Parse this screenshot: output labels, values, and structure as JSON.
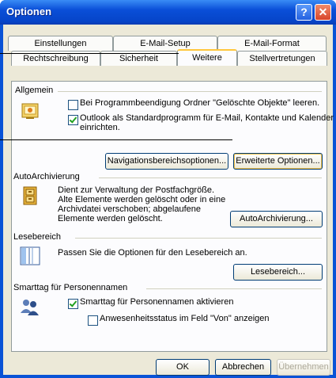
{
  "window": {
    "title": "Optionen"
  },
  "tabs": {
    "row1": [
      "Einstellungen",
      "E-Mail-Setup",
      "E-Mail-Format"
    ],
    "row2": [
      "Rechtschreibung",
      "Sicherheit",
      "Weitere",
      "Stellvertretungen"
    ]
  },
  "allgemein": {
    "heading": "Allgemein",
    "opt1": "Bei Programmbeendigung Ordner \"Gelöschte Objekte\" leeren.",
    "opt2_line1": "Outlook als Standardprogramm für E-Mail, Kontakte und Kalender",
    "opt2_line2": "einrichten.",
    "nav_button": "Navigationsbereichsoptionen...",
    "adv_button": "Erweiterte Optionen..."
  },
  "autoarchiv": {
    "heading": "AutoArchivierung",
    "desc1": "Dient zur Verwaltung der Postfachgröße.",
    "desc2": "Alte Elemente werden gelöscht oder in eine",
    "desc3": "Archivdatei verschoben; abgelaufene",
    "desc4": "Elemente werden gelöscht.",
    "button": "AutoArchivierung..."
  },
  "lesebereich": {
    "heading": "Lesebereich",
    "desc": "Passen Sie die Optionen für den Lesebereich an.",
    "button": "Lesebereich..."
  },
  "smarttag": {
    "heading": "Smarttag für Personennamen",
    "opt1": "Smarttag für Personennamen aktivieren",
    "opt2": "Anwesenheitsstatus im Feld \"Von\" anzeigen"
  },
  "footer": {
    "ok": "OK",
    "cancel": "Abbrechen",
    "apply": "Übernehmen"
  },
  "colors": {
    "titlebar": "#0a4fd8",
    "dialog_bg": "#ece9d8",
    "panel_bg": "#fcfcfe",
    "tab_highlight": "#ffc73c"
  }
}
